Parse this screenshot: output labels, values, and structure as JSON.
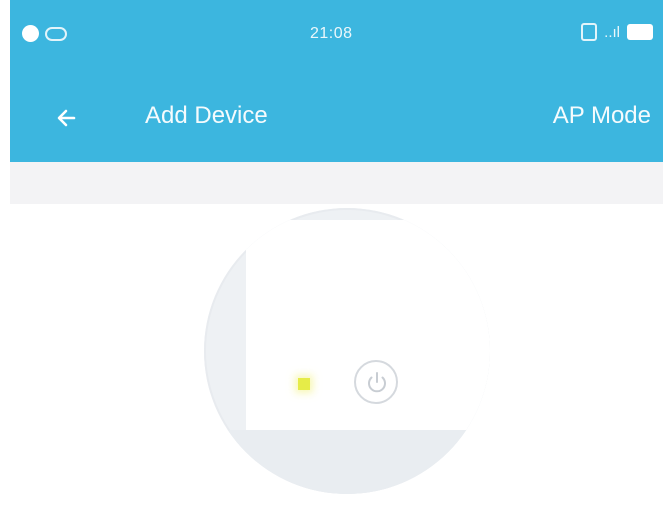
{
  "status_bar": {
    "time": "21:08",
    "signal": "..ıl",
    "icons": [
      "notification-dot-icon",
      "infinity-icon",
      "sim-icon",
      "battery-icon"
    ]
  },
  "app_bar": {
    "title": "Add Device",
    "action_label": "AP Mode",
    "back_icon": "arrow-left-icon"
  },
  "device_illustration": {
    "led_color": "#e6ec48",
    "power_icon": "power-icon"
  },
  "colors": {
    "primary": "#3cb6df",
    "background": "#f6f6f8"
  }
}
